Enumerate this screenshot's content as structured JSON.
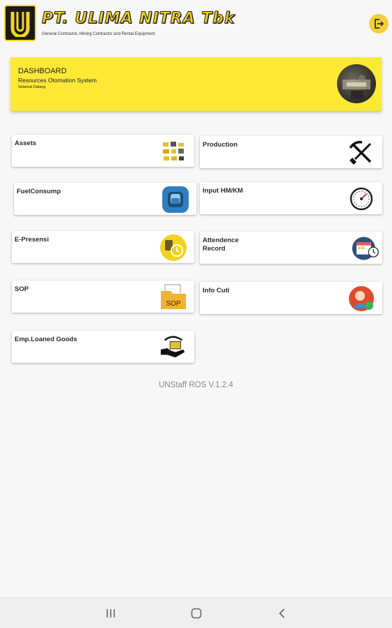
{
  "header": {
    "company_name": "PT. ULIMA NITRA Tbk",
    "company_tagline": "General Contractor, Mining Contractor and Rental Equipment",
    "logo_icon": "ulima-logo-icon",
    "logout_icon": "logout-icon"
  },
  "dashboard": {
    "title": "DASHBOARD",
    "subtitle": "Resources Otomation System",
    "greeting": "Selamat Datang",
    "avatar_icon": "profile-avatar"
  },
  "menu": [
    {
      "label": "Assets",
      "icon": "assets-icon"
    },
    {
      "label": "Production",
      "icon": "pickaxe-shovel-icon"
    },
    {
      "label": "FuelConsump",
      "icon": "fuel-icon"
    },
    {
      "label": "Input HM/KM",
      "icon": "speedometer-icon"
    },
    {
      "label": "E-Presensi",
      "icon": "fingerprint-clock-icon"
    },
    {
      "label": "Attendence\nRecord",
      "icon": "calendar-clock-icon"
    },
    {
      "label": "SOP",
      "icon": "sop-folder-icon"
    },
    {
      "label": "Info Cuti",
      "icon": "leave-info-icon"
    },
    {
      "label": "Emp.Loaned Goods",
      "icon": "hand-goods-icon"
    }
  ],
  "footer": {
    "version": "UNStaff ROS V.1.2.4"
  },
  "navbar": {
    "recent_icon": "recent-apps-icon",
    "home_icon": "home-icon",
    "back_icon": "back-icon"
  },
  "colors": {
    "accent_yellow": "#fde935",
    "header_yellow": "#f2d21c",
    "background": "#f7f7f7"
  }
}
